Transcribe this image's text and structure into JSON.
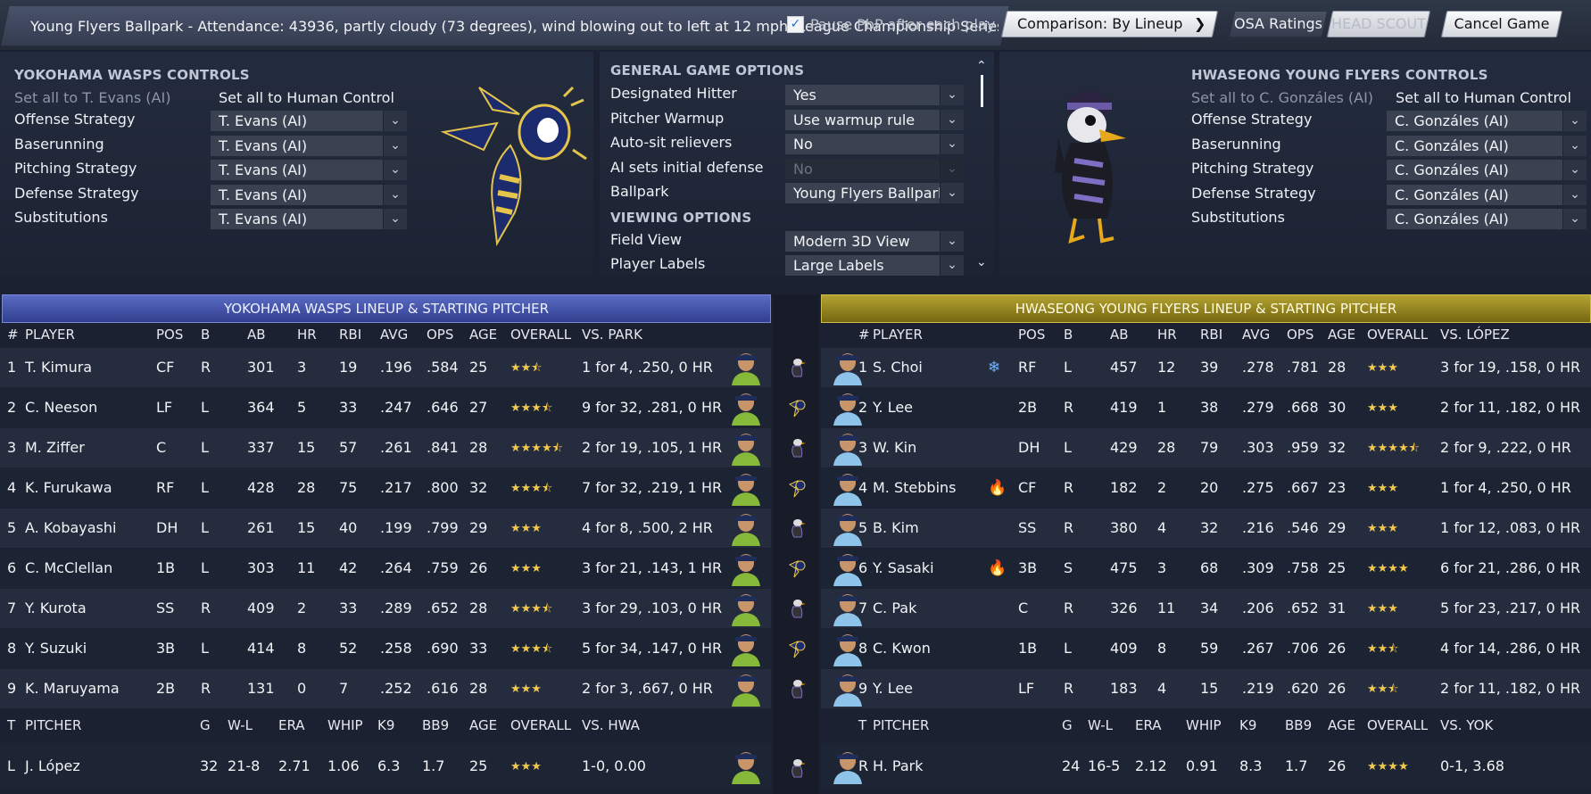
{
  "top": {
    "game_info": "Young Flyers Ballpark - Attendance: 43936, partly cloudy (73  degrees), wind blowing out to left at 12 mph, League Championship Series: Series",
    "pause_checked": true,
    "pause_label": "Pause PbP after each play",
    "comparison_label": "Comparison: By Lineup",
    "osa_label": "OSA Ratings",
    "head_scout_label": "HEAD SCOUT",
    "cancel_label": "Cancel Game"
  },
  "wasps_controls": {
    "title": "YOKOHAMA WASPS CONTROLS",
    "set_ai": "Set all to T. Evans (AI)",
    "set_human": "Set all to Human Control",
    "rows": [
      {
        "label": "Offense Strategy",
        "value": "T. Evans (AI)"
      },
      {
        "label": "Baserunning",
        "value": "T. Evans (AI)"
      },
      {
        "label": "Pitching Strategy",
        "value": "T. Evans (AI)"
      },
      {
        "label": "Defense Strategy",
        "value": "T. Evans (AI)"
      },
      {
        "label": "Substitutions",
        "value": "T. Evans (AI)"
      }
    ]
  },
  "options": {
    "general_title": "GENERAL GAME OPTIONS",
    "general": [
      {
        "label": "Designated Hitter",
        "value": "Yes",
        "disabled": false
      },
      {
        "label": "Pitcher Warmup",
        "value": "Use warmup rule",
        "disabled": false
      },
      {
        "label": "Auto-sit relievers",
        "value": "No",
        "disabled": false
      },
      {
        "label": "AI sets initial defense",
        "value": "No",
        "disabled": true
      },
      {
        "label": "Ballpark",
        "value": "Young Flyers Ballpark",
        "disabled": false
      }
    ],
    "viewing_title": "VIEWING OPTIONS",
    "viewing": [
      {
        "label": "Field View",
        "value": "Modern 3D View"
      },
      {
        "label": "Player Labels",
        "value": "Large Labels"
      }
    ]
  },
  "flyers_controls": {
    "title": "HWASEONG YOUNG FLYERS CONTROLS",
    "set_ai": "Set all to C. Gonzáles (AI)",
    "set_human": "Set all to Human Control",
    "rows": [
      {
        "label": "Offense Strategy",
        "value": "C. Gonzáles (AI)"
      },
      {
        "label": "Baserunning",
        "value": "C. Gonzáles (AI)"
      },
      {
        "label": "Pitching Strategy",
        "value": "C. Gonzáles (AI)"
      },
      {
        "label": "Defense Strategy",
        "value": "C. Gonzáles (AI)"
      },
      {
        "label": "Substitutions",
        "value": "C. Gonzáles (AI)"
      }
    ]
  },
  "wasps_lineup": {
    "title": "YOKOHAMA WASPS LINEUP & STARTING PITCHER",
    "columns": [
      "#",
      "PLAYER",
      "POS",
      "B",
      "AB",
      "HR",
      "RBI",
      "AVG",
      "OPS",
      "AGE",
      "OVERALL",
      "VS. PARK"
    ],
    "players": [
      {
        "num": "1",
        "name": "T. Kimura",
        "pos": "CF",
        "b": "R",
        "ab": "301",
        "hr": "3",
        "rbi": "19",
        "avg": ".196",
        "ops": ".584",
        "age": "25",
        "overall": 2.5,
        "vs": "1 for 4, .250, 0 HR"
      },
      {
        "num": "2",
        "name": "C. Neeson",
        "pos": "LF",
        "b": "L",
        "ab": "364",
        "hr": "5",
        "rbi": "33",
        "avg": ".247",
        "ops": ".646",
        "age": "27",
        "overall": 3.5,
        "vs": "9 for 32, .281, 0 HR"
      },
      {
        "num": "3",
        "name": "M. Ziffer",
        "pos": "C",
        "b": "L",
        "ab": "337",
        "hr": "15",
        "rbi": "57",
        "avg": ".261",
        "ops": ".841",
        "age": "28",
        "overall": 4.5,
        "vs": "2 for 19, .105, 1 HR"
      },
      {
        "num": "4",
        "name": "K. Furukawa",
        "pos": "RF",
        "b": "L",
        "ab": "428",
        "hr": "28",
        "rbi": "75",
        "avg": ".217",
        "ops": ".800",
        "age": "32",
        "overall": 3.5,
        "vs": "7 for 32, .219, 1 HR"
      },
      {
        "num": "5",
        "name": "A. Kobayashi",
        "pos": "DH",
        "b": "L",
        "ab": "261",
        "hr": "15",
        "rbi": "40",
        "avg": ".199",
        "ops": ".799",
        "age": "29",
        "overall": 3,
        "vs": "4 for 8, .500, 2 HR"
      },
      {
        "num": "6",
        "name": "C. McClellan",
        "pos": "1B",
        "b": "L",
        "ab": "303",
        "hr": "11",
        "rbi": "42",
        "avg": ".264",
        "ops": ".759",
        "age": "26",
        "overall": 3,
        "vs": "3 for 21, .143, 1 HR"
      },
      {
        "num": "7",
        "name": "Y. Kurota",
        "pos": "SS",
        "b": "R",
        "ab": "409",
        "hr": "2",
        "rbi": "33",
        "avg": ".289",
        "ops": ".652",
        "age": "28",
        "overall": 3.5,
        "vs": "3 for 29, .103, 0 HR"
      },
      {
        "num": "8",
        "name": "Y. Suzuki",
        "pos": "3B",
        "b": "L",
        "ab": "414",
        "hr": "8",
        "rbi": "52",
        "avg": ".258",
        "ops": ".690",
        "age": "33",
        "overall": 3.5,
        "vs": "5 for 34, .147, 0 HR"
      },
      {
        "num": "9",
        "name": "K. Maruyama",
        "pos": "2B",
        "b": "R",
        "ab": "131",
        "hr": "0",
        "rbi": "7",
        "avg": ".252",
        "ops": ".616",
        "age": "28",
        "overall": 3,
        "vs": "2 for 3, .667, 0 HR"
      }
    ],
    "pitcher_columns": [
      "T",
      "PITCHER",
      "G",
      "W-L",
      "ERA",
      "WHIP",
      "K9",
      "BB9",
      "AGE",
      "OVERALL",
      "VS. HWA"
    ],
    "pitcher": {
      "t": "L",
      "name": "J. López",
      "g": "32",
      "wl": "21-8",
      "era": "2.71",
      "whip": "1.06",
      "k9": "6.3",
      "bb9": "1.7",
      "age": "25",
      "overall": 3,
      "vs": "1-0, 0.00"
    }
  },
  "flyers_lineup": {
    "title": "HWASEONG YOUNG FLYERS LINEUP & STARTING PITCHER",
    "columns": [
      "#",
      "PLAYER",
      "POS",
      "B",
      "AB",
      "HR",
      "RBI",
      "AVG",
      "OPS",
      "AGE",
      "OVERALL",
      "VS. LÓPEZ"
    ],
    "players": [
      {
        "num": "1",
        "name": "S. Choi",
        "status": "cold",
        "pos": "RF",
        "b": "L",
        "ab": "457",
        "hr": "12",
        "rbi": "39",
        "avg": ".278",
        "ops": ".781",
        "age": "28",
        "overall": 3,
        "vs": "3 for 19, .158, 0 HR"
      },
      {
        "num": "2",
        "name": "Y. Lee",
        "status": "",
        "pos": "2B",
        "b": "R",
        "ab": "419",
        "hr": "1",
        "rbi": "38",
        "avg": ".279",
        "ops": ".668",
        "age": "30",
        "overall": 3,
        "vs": "2 for 11, .182, 0 HR"
      },
      {
        "num": "3",
        "name": "W. Kin",
        "status": "",
        "pos": "DH",
        "b": "L",
        "ab": "429",
        "hr": "28",
        "rbi": "79",
        "avg": ".303",
        "ops": ".959",
        "age": "32",
        "overall": 4.5,
        "vs": "2 for 9, .222, 0 HR"
      },
      {
        "num": "4",
        "name": "M. Stebbins",
        "status": "hot",
        "pos": "CF",
        "b": "R",
        "ab": "182",
        "hr": "2",
        "rbi": "20",
        "avg": ".275",
        "ops": ".667",
        "age": "23",
        "overall": 3,
        "vs": "1 for 4, .250, 0 HR"
      },
      {
        "num": "5",
        "name": "B. Kim",
        "status": "",
        "pos": "SS",
        "b": "R",
        "ab": "380",
        "hr": "4",
        "rbi": "32",
        "avg": ".216",
        "ops": ".546",
        "age": "29",
        "overall": 3,
        "vs": "1 for 12, .083, 0 HR"
      },
      {
        "num": "6",
        "name": "Y. Sasaki",
        "status": "hot",
        "pos": "3B",
        "b": "S",
        "ab": "475",
        "hr": "3",
        "rbi": "68",
        "avg": ".309",
        "ops": ".758",
        "age": "25",
        "overall": 4,
        "vs": "6 for 21, .286, 0 HR"
      },
      {
        "num": "7",
        "name": "C. Pak",
        "status": "",
        "pos": "C",
        "b": "R",
        "ab": "326",
        "hr": "11",
        "rbi": "34",
        "avg": ".206",
        "ops": ".652",
        "age": "31",
        "overall": 3,
        "vs": "5 for 23, .217, 0 HR"
      },
      {
        "num": "8",
        "name": "C. Kwon",
        "status": "",
        "pos": "1B",
        "b": "L",
        "ab": "409",
        "hr": "8",
        "rbi": "59",
        "avg": ".267",
        "ops": ".706",
        "age": "26",
        "overall": 2.5,
        "vs": "4 for 14, .286, 0 HR"
      },
      {
        "num": "9",
        "name": "Y. Lee",
        "status": "",
        "pos": "LF",
        "b": "R",
        "ab": "183",
        "hr": "4",
        "rbi": "15",
        "avg": ".219",
        "ops": ".620",
        "age": "26",
        "overall": 2.5,
        "vs": "2 for 11, .182, 0 HR"
      }
    ],
    "pitcher_columns": [
      "T",
      "PITCHER",
      "G",
      "W-L",
      "ERA",
      "WHIP",
      "K9",
      "BB9",
      "AGE",
      "OVERALL",
      "VS. YOK"
    ],
    "pitcher": {
      "t": "R",
      "name": "H. Park",
      "g": "24",
      "wl": "16-5",
      "era": "2.12",
      "whip": "0.91",
      "k9": "8.3",
      "bb9": "1.7",
      "age": "26",
      "overall": 4,
      "vs": "0-1, 3.68"
    }
  },
  "icons": {
    "hot": "flame-icon",
    "cold": "snowflake-icon",
    "wasps_logo": "wasp-logo",
    "flyers_logo": "bird-logo"
  },
  "colors": {
    "wasps_primary": "#3a4aa8",
    "flyers_primary": "#a8951f",
    "stars": "#f3c84c",
    "wasps_jersey": "#86b83a",
    "flyers_jersey": "#8ec3ea"
  }
}
